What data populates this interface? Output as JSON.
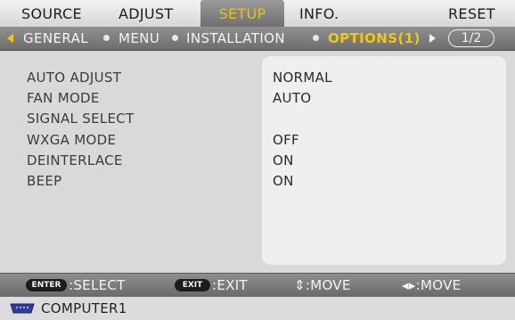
{
  "tabs": [
    "SOURCE",
    "ADJUST",
    "SETUP",
    "INFO.",
    "RESET"
  ],
  "active_tab": "SETUP",
  "subtabs": [
    "GENERAL",
    "MENU",
    "INSTALLATION",
    "OPTIONS(1)"
  ],
  "active_subtab": "OPTIONS(1)",
  "page_indicator": "1/2",
  "settings": [
    {
      "label": "AUTO ADJUST",
      "value": "NORMAL"
    },
    {
      "label": "FAN MODE",
      "value": "AUTO"
    },
    {
      "label": "SIGNAL SELECT",
      "value": ""
    },
    {
      "label": "WXGA MODE",
      "value": "OFF"
    },
    {
      "label": "DEINTERLACE",
      "value": "ON"
    },
    {
      "label": "BEEP",
      "value": "ON"
    }
  ],
  "help": {
    "enter_key": "ENTER",
    "enter_text": ":SELECT",
    "exit_key": "EXIT",
    "exit_text": ":EXIT",
    "move_vertical": "⇕:MOVE",
    "move_horizontal": "◂▸:MOVE"
  },
  "source": "COMPUTER1",
  "colors": {
    "active_tab_text": "#e3c11e",
    "active_subtab_text": "#f2c615",
    "value_panel": "#efefef"
  }
}
